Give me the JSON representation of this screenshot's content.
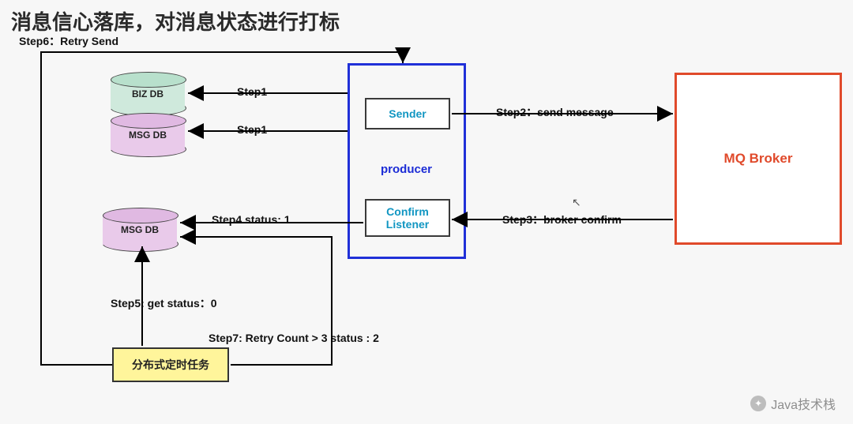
{
  "title": "消息信心落库，对消息状态进行打标",
  "dbs": {
    "biz": "BIZ DB",
    "msg1": "MSG DB",
    "msg2": "MSG DB"
  },
  "producer": {
    "label": "producer",
    "sender": "Sender",
    "confirm": "Confirm\nListener"
  },
  "broker": "MQ Broker",
  "taskbox": "分布式定时任务",
  "steps": {
    "s1a": "Step1",
    "s1b": "Step1",
    "s2": "Step2：send message",
    "s3": "Step3：broker confirm",
    "s4": "Step4 status: 1",
    "s5": "Step5: get status：0",
    "s6": "Step6：Retry Send",
    "s7": "Step7: Retry Count > 3 status : 2"
  },
  "watermark": "Java技术栈"
}
